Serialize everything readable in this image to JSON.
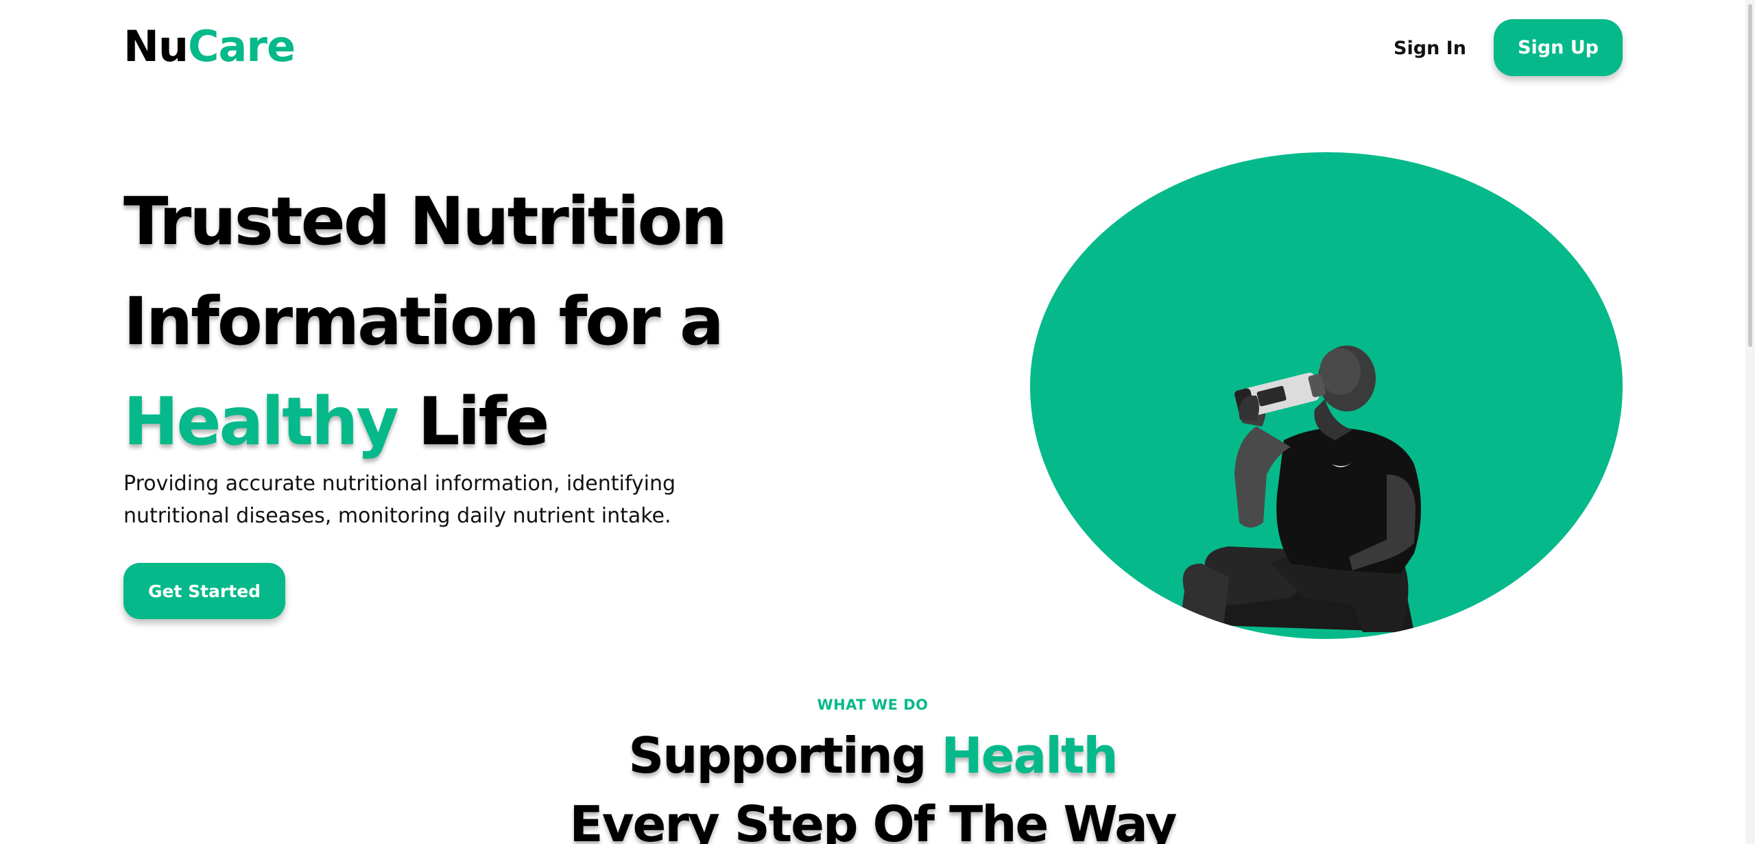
{
  "navbar": {
    "logo_part1": "Nu",
    "logo_part2": "Care",
    "sign_in_label": "Sign In",
    "sign_up_label": "Sign Up"
  },
  "hero": {
    "title_line1": "Trusted Nutrition",
    "title_line2": "Information for a",
    "title_line3_highlight": "Healthy",
    "title_line3_rest": " Life",
    "description": "Providing accurate nutritional information, identifying nutritional diseases, monitoring daily nutrient intake.",
    "cta_label": "Get Started",
    "image_icon": "athlete-drinking-shaker-image"
  },
  "section": {
    "eyebrow": "WHAT WE DO",
    "title_part1": "Supporting ",
    "title_highlight": "Health",
    "title_line2": "Every Step Of The Way"
  },
  "colors": {
    "accent": "#06b98a",
    "text": "#000000",
    "background": "#ffffff"
  }
}
